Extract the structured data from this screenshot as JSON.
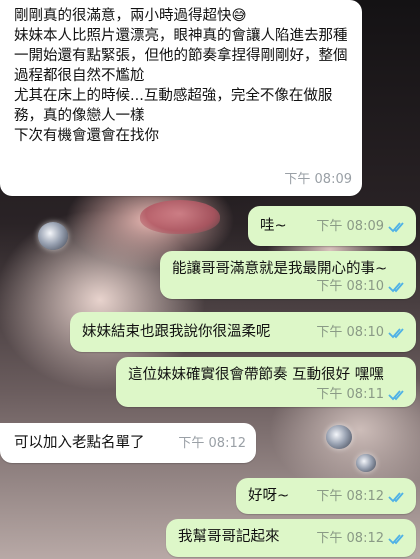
{
  "messages": [
    {
      "dir": "in",
      "text": "剛剛真的很滿意，兩小時過得超快😅\n妹妹本人比照片還漂亮，眼神真的會讓人陷進去那種\n一開始還有點緊張，但他的節奏拿捏得剛剛好，整個過程都很自然不尷尬\n尤其在床上的時候...互動感超強，完全不像在做服務，真的像戀人一樣\n下次有機會還會在找你",
      "time": "下午 08:09"
    },
    {
      "dir": "out",
      "text": "哇~",
      "time": "下午 08:09",
      "read": true
    },
    {
      "dir": "out",
      "text": "能讓哥哥滿意就是我最開心的事~",
      "time": "下午 08:10",
      "read": true
    },
    {
      "dir": "out",
      "text": "妹妹結束也跟我說你很溫柔呢",
      "time": "下午 08:10",
      "read": true
    },
    {
      "dir": "out",
      "text": "這位妹妹確實很會帶節奏 互動很好 嘿嘿",
      "time": "下午 08:11",
      "read": true
    },
    {
      "dir": "in",
      "text": "可以加入老點名單了",
      "time": "下午 08:12"
    },
    {
      "dir": "out",
      "text": "好呀~",
      "time": "下午 08:12",
      "read": true
    },
    {
      "dir": "out",
      "text": "我幫哥哥記起來",
      "time": "下午 08:12",
      "read": true
    }
  ],
  "colors": {
    "incoming": "#ffffff",
    "outgoing": "#ddf7c8",
    "read_tick": "#4fb1e6"
  }
}
